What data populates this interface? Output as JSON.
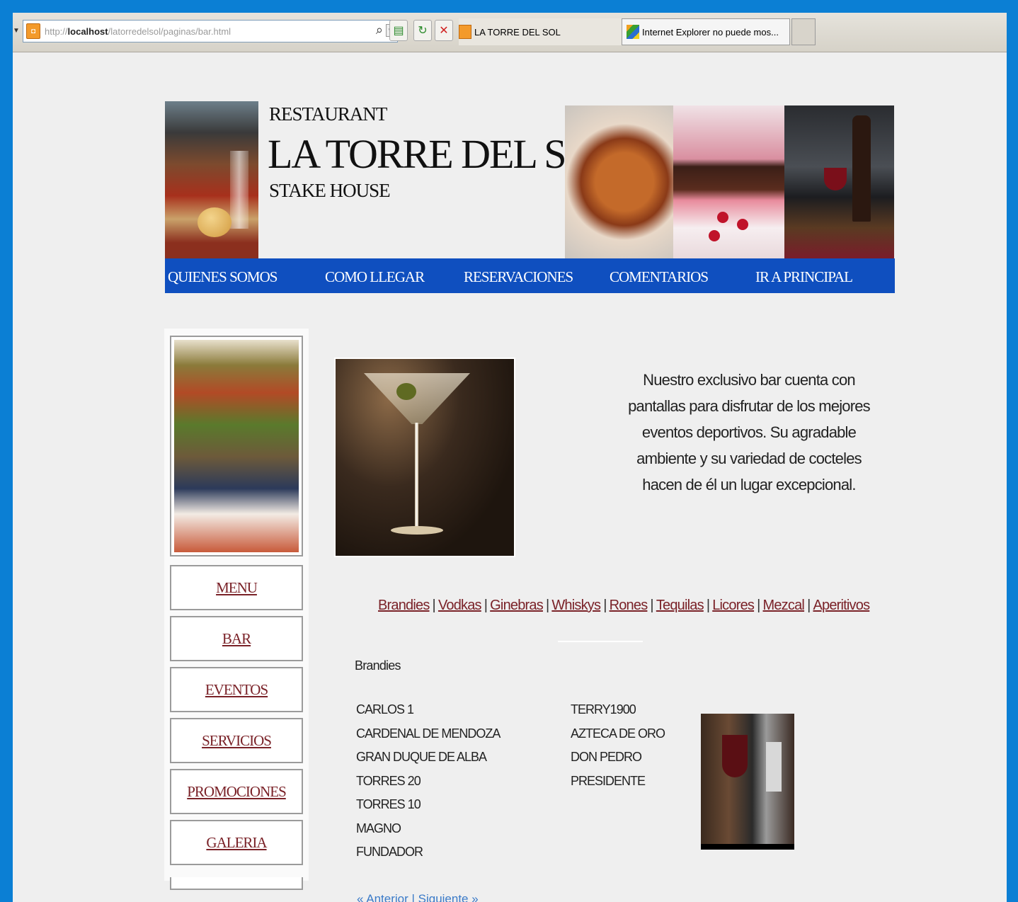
{
  "browser": {
    "address": {
      "proto": "http://",
      "host": "localhost",
      "path": "/latorredelsol/paginas/bar.html"
    },
    "tabs": [
      {
        "label": "LA TORRE DEL SOL"
      },
      {
        "label": "Internet Explorer no puede mos..."
      }
    ],
    "tab_close": "x"
  },
  "header": {
    "kicker": "RESTAURANT",
    "title": "LA TORRE DEL SOL",
    "subtitle": "STAKE HOUSE"
  },
  "nav": [
    "QUIENES SOMOS",
    "COMO LLEGAR",
    "RESERVACIONES",
    "COMENTARIOS",
    "IR A PRINCIPAL"
  ],
  "sidebar": [
    "MENU",
    "BAR",
    "EVENTOS",
    "SERVICIOS",
    "PROMOCIONES",
    "GALERIA"
  ],
  "description": "Nuestro exclusivo bar cuenta con pantallas para disfrutar de los mejores eventos deportivos. Su agradable ambiente y su variedad de cocteles hacen de él un lugar excepcional.",
  "categories": [
    "Brandies",
    "Vodkas",
    "Ginebras",
    "Whiskys",
    "Rones",
    "Tequilas",
    "Licores",
    "Mezcal",
    "Aperitivos"
  ],
  "section_title": "Brandies",
  "brandies_col1": [
    "CARLOS 1",
    "CARDENAL DE MENDOZA",
    "GRAN DUQUE DE ALBA",
    "TORRES 20",
    "TORRES 10",
    "MAGNO",
    "FUNDADOR"
  ],
  "brandies_col2": [
    "TERRY1900",
    "AZTECA DE ORO",
    "DON PEDRO",
    "PRESIDENTE"
  ],
  "pager": "« Anterior | Siguiente »"
}
